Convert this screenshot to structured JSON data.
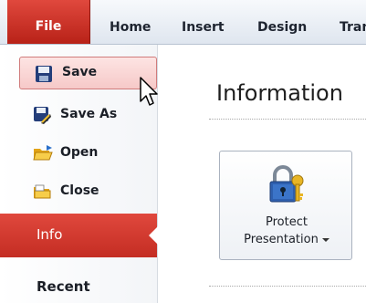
{
  "ribbon": {
    "tabs": [
      "File",
      "Home",
      "Insert",
      "Design",
      "Tran"
    ]
  },
  "backstage": {
    "commands": [
      {
        "label": "Save",
        "icon": "save-icon"
      },
      {
        "label": "Save As",
        "icon": "save-as-icon"
      },
      {
        "label": "Open",
        "icon": "open-folder-icon"
      },
      {
        "label": "Close",
        "icon": "close-folder-icon"
      }
    ],
    "nav": [
      {
        "label": "Info",
        "selected": true
      },
      {
        "label": "Recent",
        "selected": false
      }
    ]
  },
  "main": {
    "title": "Information",
    "protect_button": {
      "line1": "Protect",
      "line2": "Presentation",
      "icon": "lock-key-icon"
    }
  },
  "colors": {
    "accent": "#c42d23",
    "hover_fill": "#f6c9c8"
  }
}
